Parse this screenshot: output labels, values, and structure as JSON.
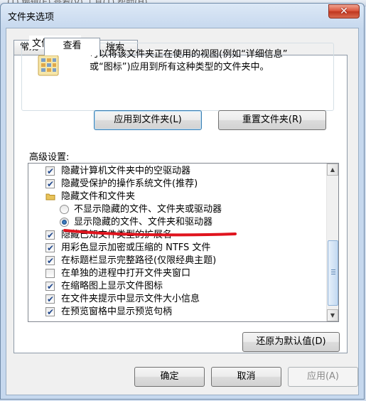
{
  "background_window": {
    "menu_text": "(T)   编辑(E)   查看(V)   工具(T)   帮助(H)"
  },
  "window": {
    "title": "文件夹选项",
    "close_glyph": "✕"
  },
  "tabs": [
    {
      "label": "常规",
      "active": false
    },
    {
      "label": "查看",
      "active": true
    },
    {
      "label": "搜索",
      "active": false
    }
  ],
  "folder_views": {
    "legend": "文件夹视图",
    "description_line1": "可以将该文件夹正在使用的视图(例如“详细信息”",
    "description_line2": "或“图标”)应用到所有这种类型的文件夹中。",
    "apply_button": "应用到文件夹(L)",
    "reset_button": "重置文件夹(R)"
  },
  "advanced": {
    "label": "高级设置:",
    "items": [
      {
        "type": "checkbox",
        "checked": true,
        "label": "隐藏计算机文件夹中的空驱动器"
      },
      {
        "type": "checkbox",
        "checked": true,
        "label": "隐藏受保护的操作系统文件(推荐)"
      },
      {
        "type": "folder",
        "label": "隐藏文件和文件夹"
      },
      {
        "type": "radio",
        "checked": false,
        "label": "不显示隐藏的文件、文件夹或驱动器"
      },
      {
        "type": "radio",
        "checked": true,
        "label": "显示隐藏的文件、文件夹和驱动器"
      },
      {
        "type": "checkbox",
        "checked": true,
        "label": "隐藏已知文件类型的扩展名"
      },
      {
        "type": "checkbox",
        "checked": true,
        "label": "用彩色显示加密或压缩的 NTFS 文件"
      },
      {
        "type": "checkbox",
        "checked": true,
        "label": "在标题栏显示完整路径(仅限经典主题)"
      },
      {
        "type": "checkbox",
        "checked": false,
        "label": "在单独的进程中打开文件夹窗口"
      },
      {
        "type": "checkbox",
        "checked": true,
        "label": "在缩略图上显示文件图标"
      },
      {
        "type": "checkbox",
        "checked": true,
        "label": "在文件夹提示中显示文件大小信息"
      },
      {
        "type": "checkbox",
        "checked": true,
        "label": "在预览窗格中显示预览句柄"
      }
    ],
    "restore_defaults_button": "还原为默认值(D)"
  },
  "footer": {
    "ok_button": "确定",
    "cancel_button": "取消",
    "apply_button": "应用(A)"
  },
  "colors": {
    "annotation_red": "#e0141e",
    "accent_blue": "#3c7fb1"
  }
}
